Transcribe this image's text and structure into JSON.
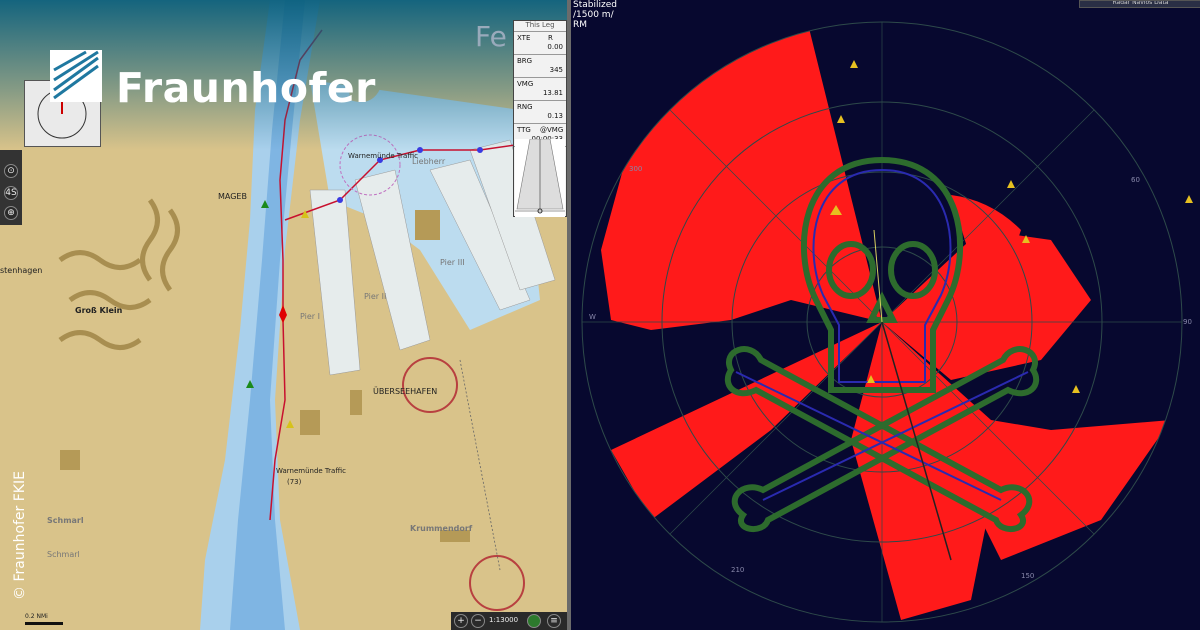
{
  "brand": {
    "name": "Fraunhofer",
    "copyright": "© Fraunhofer FKIE",
    "colors": {
      "teal": "#0a5f7d",
      "white": "#ffffff"
    }
  },
  "chart": {
    "leg_panel": {
      "title": "This Leg",
      "rows": [
        {
          "key": "XTE",
          "side": "R",
          "value": "0.00"
        },
        {
          "key": "BRG",
          "side": "",
          "value": "345"
        },
        {
          "key": "VMG",
          "side": "",
          "value": "13.81"
        },
        {
          "key": "RNG",
          "side": "",
          "value": "0.13"
        },
        {
          "key": "TTG",
          "side": "@VMG",
          "value": "00:00:33"
        }
      ]
    },
    "labels": {
      "magebay": "MAGEB",
      "gross_klein": "Groß Klein",
      "stenhagen": "stenhagen",
      "pier_ii": "Pier II",
      "pier_iii": "Pier III",
      "pier_i": "Pier I",
      "ueberseehafen": "ÜBERSEEHAFEN",
      "liebherr": "Liebherr",
      "krummendorf": "Krummendorf",
      "warnemuende_traffic_1": "Warnemünde Traffic",
      "warnemuende_traffic_2": "Warnemünde Traffic",
      "ch73": "(73)",
      "schmarl": "Schmarl",
      "schmarl2": "Schmarl",
      "scale_bar": "0.2 NMi",
      "fe": "Fe"
    },
    "toolbar": {
      "zoom_in": "+",
      "zoom_out": "−",
      "scale": "1:13000",
      "menu": "≡"
    },
    "left_tools": [
      "4S",
      "⊙",
      "⊕"
    ]
  },
  "radar": {
    "mode_line1": "Stabilized",
    "mode_line2": "/1500 m/",
    "mode_line3": "RM",
    "bearings": [
      "60",
      "W",
      "210",
      "150",
      "300",
      "90"
    ],
    "colors": {
      "echo": "#ff1a1a",
      "background": "#07082f",
      "ring": "#2e4a4a",
      "overlay_green": "#2d6b2d",
      "overlay_blue": "#2a2ab0"
    },
    "top_button": "Radar Navios Data"
  }
}
